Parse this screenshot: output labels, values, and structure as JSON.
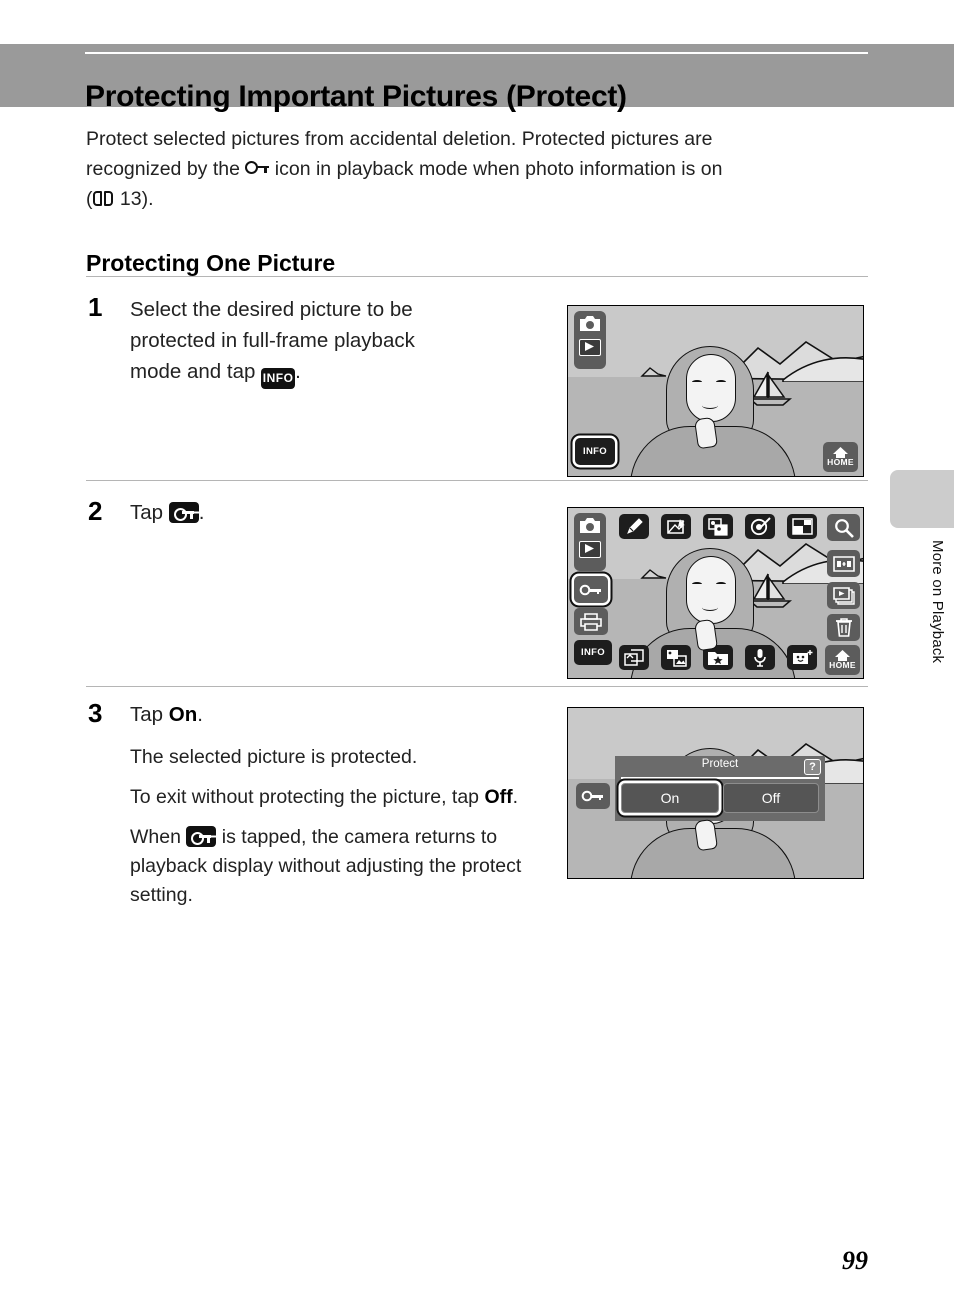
{
  "header": {
    "title": "Protecting Important Pictures (Protect)"
  },
  "intro": {
    "line1": "Protect selected pictures from accidental deletion. Protected pictures are",
    "line2_a": "recognized by the",
    "line2_icon": "protect-key-icon",
    "line2_b": "icon in playback mode when photo information is on",
    "line3_open": "(",
    "line3_icon": "book-reference-icon",
    "line3_page": "13).",
    "reference_page": "13"
  },
  "section": {
    "heading": "Protecting One Picture"
  },
  "steps": [
    {
      "number": "1",
      "line1": "Select the desired picture to be",
      "line2": "protected in full-frame playback",
      "line3_a": "mode and tap",
      "line3_icon": "INFO",
      "line3_b": "."
    },
    {
      "number": "2",
      "text_a": "Tap",
      "icon": "protect-key-icon",
      "text_b": "."
    },
    {
      "number": "3",
      "heading_a": "Tap ",
      "heading_b": "On",
      "heading_c": ".",
      "para1": "The selected picture is protected.",
      "para2_a": "To exit without protecting the picture, tap ",
      "para2_b": "Off",
      "para2_c": ".",
      "para3_a": "When",
      "para3_icon": "protect-key-icon",
      "para3_b": "is tapped, the camera returns to",
      "para3_line2": "playback display without adjusting the protect",
      "para3_line3": "setting."
    }
  ],
  "screens": {
    "screen1": {
      "name": "full-frame-playback",
      "info_button": "INFO",
      "home_button": "HOME",
      "mode_icons": [
        "camera-icon",
        "playback-icon"
      ]
    },
    "screen2": {
      "name": "playback-menu-overlay",
      "info_button": "INFO",
      "home_button": "HOME",
      "top_row_icons": [
        "quick-retouch-icon",
        "d-lighting-icon",
        "skin-softening-icon",
        "filter-effects-icon",
        "small-picture-icon"
      ],
      "right_column_icons": [
        "zoom-search-icon",
        "thumbnail-view-icon",
        "slideshow-icon",
        "delete-trash-icon"
      ],
      "left_column_icons": [
        "camera-icon",
        "playback-icon",
        "protect-key-icon",
        "print-order-icon"
      ],
      "bottom_row_icons": [
        "rotate-image-icon",
        "copy-icon",
        "favorites-folder-icon",
        "voice-memo-icon",
        "auto-sort-icon"
      ],
      "selected_icon": "protect-key-icon"
    },
    "screen3": {
      "name": "protect-dialog",
      "dialog_title": "Protect",
      "help_label": "?",
      "option_on": "On",
      "option_off": "Off",
      "selected_option": "On",
      "key_button": "protect-key-icon"
    }
  },
  "side_tab": {
    "label": "More on Playback"
  },
  "footer": {
    "page_number": "99"
  },
  "colors": {
    "header_band": "#9a9a9a",
    "screen_bg": "#c9c9c9",
    "button_grey": "#5c5c5c",
    "button_dark": "#1d1d1d",
    "side_tab": "#cccccc"
  }
}
